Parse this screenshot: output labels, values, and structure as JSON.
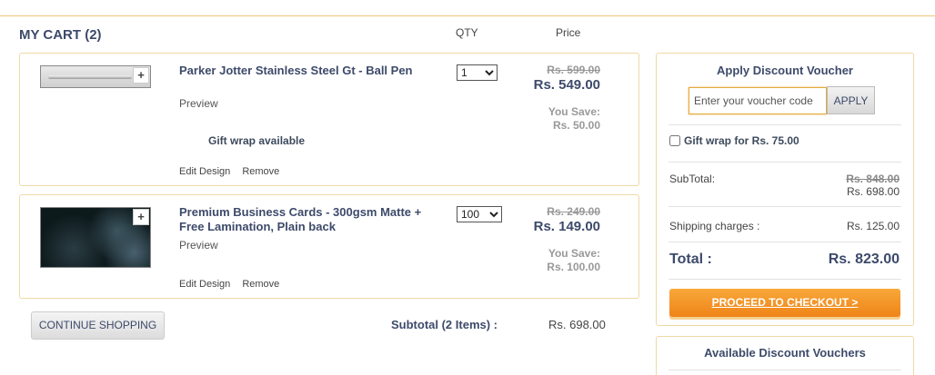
{
  "header": {
    "cart_title": "MY CART (2)",
    "qty_col": "QTY",
    "price_col": "Price"
  },
  "items": [
    {
      "name": "Parker Jotter Stainless Steel Gt - Ball Pen",
      "preview": "Preview",
      "note": "Gift wrap available",
      "edit": "Edit Design",
      "remove": "Remove",
      "qty": "1",
      "old_price": "Rs. 599.00",
      "new_price": "Rs. 549.00",
      "save_label": "You Save:",
      "save_amount": "Rs. 50.00"
    },
    {
      "name": "Premium Business Cards - 300gsm Matte + Free Lamination, Plain back",
      "preview": "Preview",
      "edit": "Edit Design",
      "remove": "Remove",
      "qty": "100",
      "old_price": "Rs. 249.00",
      "new_price": "Rs. 149.00",
      "save_label": "You Save:",
      "save_amount": "Rs. 100.00"
    }
  ],
  "footer": {
    "continue_label": "CONTINUE SHOPPING",
    "subtotal_label": "Subtotal (2 Items) :",
    "subtotal_value": "Rs. 698.00"
  },
  "summary": {
    "voucher_title": "Apply Discount Voucher",
    "voucher_placeholder": "Enter your voucher code",
    "apply_label": "APPLY",
    "gift_wrap_label": "Gift wrap for Rs. 75.00",
    "subtotal_label": "SubTotal:",
    "subtotal_old": "Rs. 848.00",
    "subtotal_new": "Rs. 698.00",
    "shipping_label": "Shipping charges :",
    "shipping_value": "Rs. 125.00",
    "total_label": "Total :",
    "total_value": "Rs. 823.00",
    "checkout_label": "PROCEED TO CHECKOUT >",
    "available_title": "Available Discount Vouchers"
  },
  "colors": {
    "accent": "#ef8418",
    "border": "#f0d9a6",
    "heading": "#3d4a6a"
  }
}
